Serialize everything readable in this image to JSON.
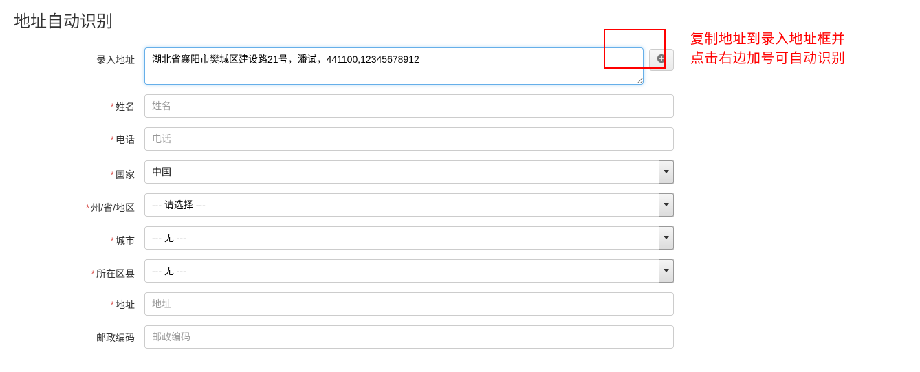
{
  "title": "地址自动识别",
  "hint_line1": "复制地址到录入地址框并",
  "hint_line2": "点击右边加号可自动识别",
  "fields": {
    "input_address": {
      "label": "录入地址",
      "value": "湖北省襄阳市樊城区建设路21号，潘试，441100,12345678912",
      "required": false
    },
    "name": {
      "label": "姓名",
      "placeholder": "姓名",
      "required": true
    },
    "phone": {
      "label": "电话",
      "placeholder": "电话",
      "required": true
    },
    "country": {
      "label": "国家",
      "value": "中国",
      "required": true
    },
    "state": {
      "label": "州/省/地区",
      "value": "--- 请选择 ---",
      "required": true
    },
    "city": {
      "label": "城市",
      "value": "--- 无 ---",
      "required": true
    },
    "district": {
      "label": "所在区县",
      "value": "--- 无 ---",
      "required": true
    },
    "address": {
      "label": "地址",
      "placeholder": "地址",
      "required": true
    },
    "postcode": {
      "label": "邮政编码",
      "placeholder": "邮政编码",
      "required": false
    }
  }
}
